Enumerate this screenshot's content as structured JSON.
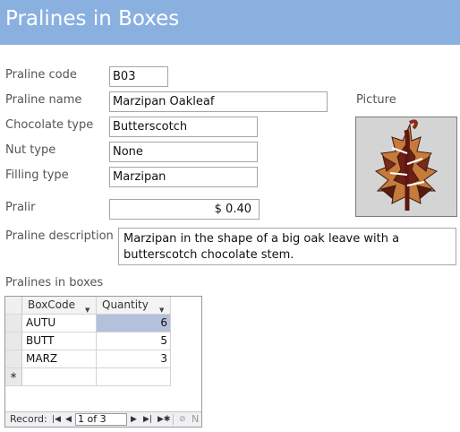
{
  "header": {
    "title": "Pralines in Boxes"
  },
  "form": {
    "praline_code": {
      "label": "Praline code",
      "value": "B03"
    },
    "praline_name": {
      "label": "Praline name",
      "value": "Marzipan Oakleaf"
    },
    "chocolate_type": {
      "label": "Chocolate type",
      "value": "Butterscotch"
    },
    "nut_type": {
      "label": "Nut type",
      "value": "None"
    },
    "filling_type": {
      "label": "Filling type",
      "value": "Marzipan"
    },
    "pralir": {
      "label": "Pralir",
      "value": "$ 0.40"
    },
    "description": {
      "label": "Praline description",
      "value": "Marzipan in the shape of a big oak leave with a butterscotch chocolate stem."
    },
    "picture_label": "Picture"
  },
  "subform": {
    "label": "Pralines in boxes",
    "columns": [
      "BoxCode",
      "Quantity"
    ],
    "rows": [
      {
        "box": "AUTU",
        "qty": "6"
      },
      {
        "box": "BUTT",
        "qty": "5"
      },
      {
        "box": "MARZ",
        "qty": "3"
      }
    ],
    "new_record_marker": "*",
    "nav": {
      "label": "Record:",
      "position": "1 of 3",
      "filter_text": "N"
    }
  },
  "colors": {
    "header_bg": "#8ab0e0",
    "selected_cell": "#b4c0dc"
  }
}
